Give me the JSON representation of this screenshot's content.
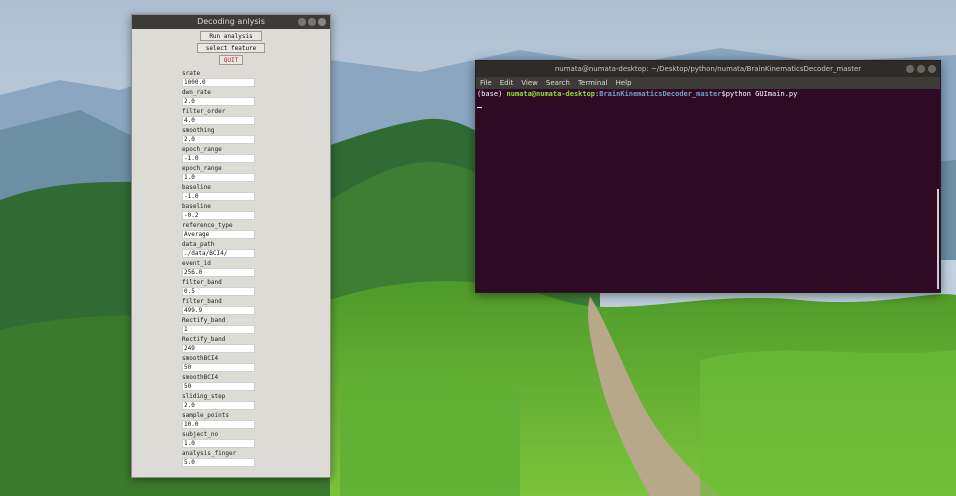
{
  "colors": {
    "terminal_bg": "#300a24",
    "prompt_user": "#8ae234",
    "prompt_path": "#729fcf",
    "quit": "#c41b1b"
  },
  "analysis_window": {
    "title": "Decoding anlysis",
    "buttons": {
      "run": "Run analysis",
      "select": "select feature",
      "quit": "QUIT"
    },
    "fields": [
      {
        "label": "srate",
        "value": "1000.0"
      },
      {
        "label": "dwn_rate",
        "value": "2.0"
      },
      {
        "label": "filter_order",
        "value": "4.0"
      },
      {
        "label": "smoothing",
        "value": "2.0"
      },
      {
        "label": "epoch_range",
        "value": "-1.0"
      },
      {
        "label": "epoch_range",
        "value": "1.0"
      },
      {
        "label": "baseline",
        "value": "-1.0"
      },
      {
        "label": "baseline",
        "value": "-0.2"
      },
      {
        "label": "reference_type",
        "value": "Average"
      },
      {
        "label": "data_path",
        "value": "./data/BCI4/"
      },
      {
        "label": "event_id",
        "value": "256.0"
      },
      {
        "label": "filter_band",
        "value": "0.5"
      },
      {
        "label": "filter_band",
        "value": "499.9"
      },
      {
        "label": "Rectify_band",
        "value": "1"
      },
      {
        "label": "Rectify_band",
        "value": "249"
      },
      {
        "label": "smoothBCI4",
        "value": "50"
      },
      {
        "label": "smoothBCI4",
        "value": "50"
      },
      {
        "label": "sliding_step",
        "value": "2.0"
      },
      {
        "label": "sample_points",
        "value": "10.0"
      },
      {
        "label": "subject_no",
        "value": "1.0"
      },
      {
        "label": "analysis_finger",
        "value": "5.0"
      }
    ]
  },
  "terminal": {
    "title": "numata@numata-desktop: ~/Desktop/python/numata/BrainKinematicsDecoder_master",
    "menu": [
      "File",
      "Edit",
      "View",
      "Search",
      "Terminal",
      "Help"
    ],
    "prompt_env": "(base) ",
    "prompt_user": "numata@numata-desktop",
    "prompt_sep": ":",
    "prompt_path": "BrainKinematicsDecoder_master",
    "prompt_sym": "$",
    "command": "python GUImain.py"
  }
}
